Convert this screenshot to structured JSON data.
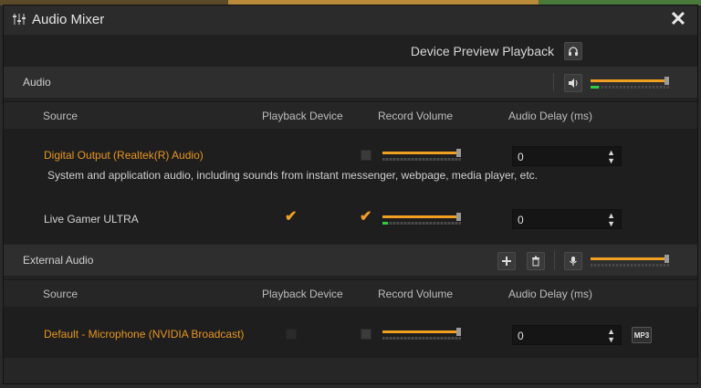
{
  "window": {
    "title": "Audio Mixer",
    "icon": "mixer-sliders-icon",
    "close_icon": "close-icon"
  },
  "device_preview": {
    "label": "Device Preview Playback",
    "icon": "headphones-icon"
  },
  "audio_section": {
    "label": "Audio",
    "speaker_icon": "speaker-icon",
    "master_volume_fraction": 0.97,
    "master_meter_fraction": 0.1
  },
  "columns": {
    "source": "Source",
    "playback_device": "Playback Device",
    "record_volume": "Record Volume",
    "audio_delay": "Audio Delay (ms)"
  },
  "audio_sources": [
    {
      "name": "Digital Output (Realtek(R) Audio)",
      "description": "System and application audio, including sounds from instant messenger, webpage, media player, etc.",
      "playback_checked": false,
      "record_checked": false,
      "volume_fraction": 0.97,
      "meter_fraction": 0.0,
      "delay": "0"
    },
    {
      "name": "Live Gamer ULTRA",
      "playback_checked": true,
      "record_checked": true,
      "volume_fraction": 0.97,
      "meter_fraction": 0.07,
      "delay": "0"
    }
  ],
  "external_section": {
    "label": "External Audio",
    "add_icon": "plus-icon",
    "delete_icon": "trash-icon",
    "mic_icon": "microphone-icon",
    "master_volume_fraction": 0.97,
    "master_meter_fraction": 0.0
  },
  "external_sources": [
    {
      "name": "Default - Microphone (NVIDIA Broadcast)",
      "playback_checked": false,
      "record_checked": false,
      "volume_fraction": 0.97,
      "meter_fraction": 0.0,
      "delay": "0",
      "mp3_label": "MP3"
    }
  ],
  "colors": {
    "accent": "#f0a020",
    "meter_green": "#2ecc40",
    "window_bg": "#222222"
  }
}
